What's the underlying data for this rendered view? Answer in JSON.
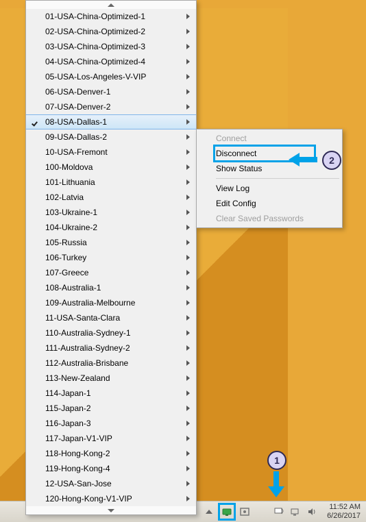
{
  "desktop": {
    "accent": "#e8a838"
  },
  "menu": {
    "selected_index": 7,
    "items": [
      {
        "label": "01-USA-China-Optimized-1",
        "id": "01-usa-china-optimized-1"
      },
      {
        "label": "02-USA-China-Optimized-2",
        "id": "02-usa-china-optimized-2"
      },
      {
        "label": "03-USA-China-Optimized-3",
        "id": "03-usa-china-optimized-3"
      },
      {
        "label": "04-USA-China-Optimized-4",
        "id": "04-usa-china-optimized-4"
      },
      {
        "label": "05-USA-Los-Angeles-V-VIP",
        "id": "05-usa-los-angeles-v-vip"
      },
      {
        "label": "06-USA-Denver-1",
        "id": "06-usa-denver-1"
      },
      {
        "label": "07-USA-Denver-2",
        "id": "07-usa-denver-2"
      },
      {
        "label": "08-USA-Dallas-1",
        "id": "08-usa-dallas-1"
      },
      {
        "label": "09-USA-Dallas-2",
        "id": "09-usa-dallas-2"
      },
      {
        "label": "10-USA-Fremont",
        "id": "10-usa-fremont"
      },
      {
        "label": "100-Moldova",
        "id": "100-moldova"
      },
      {
        "label": "101-Lithuania",
        "id": "101-lithuania"
      },
      {
        "label": "102-Latvia",
        "id": "102-latvia"
      },
      {
        "label": "103-Ukraine-1",
        "id": "103-ukraine-1"
      },
      {
        "label": "104-Ukraine-2",
        "id": "104-ukraine-2"
      },
      {
        "label": "105-Russia",
        "id": "105-russia"
      },
      {
        "label": "106-Turkey",
        "id": "106-turkey"
      },
      {
        "label": "107-Greece",
        "id": "107-greece"
      },
      {
        "label": "108-Australia-1",
        "id": "108-australia-1"
      },
      {
        "label": "109-Australia-Melbourne",
        "id": "109-australia-melbourne"
      },
      {
        "label": "11-USA-Santa-Clara",
        "id": "11-usa-santa-clara"
      },
      {
        "label": "110-Australia-Sydney-1",
        "id": "110-australia-sydney-1"
      },
      {
        "label": "111-Australia-Sydney-2",
        "id": "111-australia-sydney-2"
      },
      {
        "label": "112-Australia-Brisbane",
        "id": "112-australia-brisbane"
      },
      {
        "label": "113-New-Zealand",
        "id": "113-new-zealand"
      },
      {
        "label": "114-Japan-1",
        "id": "114-japan-1"
      },
      {
        "label": "115-Japan-2",
        "id": "115-japan-2"
      },
      {
        "label": "116-Japan-3",
        "id": "116-japan-3"
      },
      {
        "label": "117-Japan-V1-VIP",
        "id": "117-japan-v1-vip"
      },
      {
        "label": "118-Hong-Kong-2",
        "id": "118-hong-kong-2"
      },
      {
        "label": "119-Hong-Kong-4",
        "id": "119-hong-kong-4"
      },
      {
        "label": "12-USA-San-Jose",
        "id": "12-usa-san-jose"
      },
      {
        "label": "120-Hong-Kong-V1-VIP",
        "id": "120-hong-kong-v1-vip"
      }
    ]
  },
  "submenu": {
    "items": [
      {
        "label": "Connect",
        "id": "connect",
        "disabled": true
      },
      {
        "label": "Disconnect",
        "id": "disconnect",
        "highlight": true
      },
      {
        "label": "Show Status",
        "id": "show-status"
      },
      {
        "sep": true
      },
      {
        "label": "View Log",
        "id": "view-log"
      },
      {
        "label": "Edit Config",
        "id": "edit-config"
      },
      {
        "label": "Clear Saved Passwords",
        "id": "clear-saved-passwords",
        "disabled": true
      }
    ]
  },
  "annotations": {
    "badge1": "1",
    "badge2": "2"
  },
  "taskbar": {
    "time": "11:52 AM",
    "date": "6/26/2017"
  }
}
